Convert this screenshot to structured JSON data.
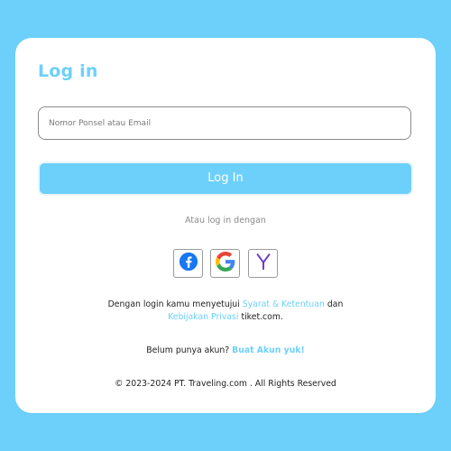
{
  "login": {
    "title": "Log in",
    "input_placeholder": "Nomor Ponsel atau Email",
    "button_label": "Log In",
    "alt_login_text": "Atau log in dengan"
  },
  "social": [
    {
      "name": "facebook-icon",
      "color": "#1877f2"
    },
    {
      "name": "google-icon",
      "color": "#4285f4"
    },
    {
      "name": "yahoo-icon",
      "color": "#6b3fc8",
      "glyph": "Y"
    }
  ],
  "terms": {
    "prefix": "Dengan login kamu menyetujui ",
    "link1": "Syarat & Ketentuan",
    "middle": " dan",
    "link2": "Kebijakan Privasi",
    "suffix": " tiket.com."
  },
  "signup": {
    "question": "Belum punya akun? ",
    "link": "Buat Akun yuk!"
  },
  "footer": {
    "copyright": "© 2023-2024 PT. Traveling.com . All Rights Reserved"
  },
  "colors": {
    "accent": "#6dd0fb",
    "background": "#6dd0fb"
  }
}
